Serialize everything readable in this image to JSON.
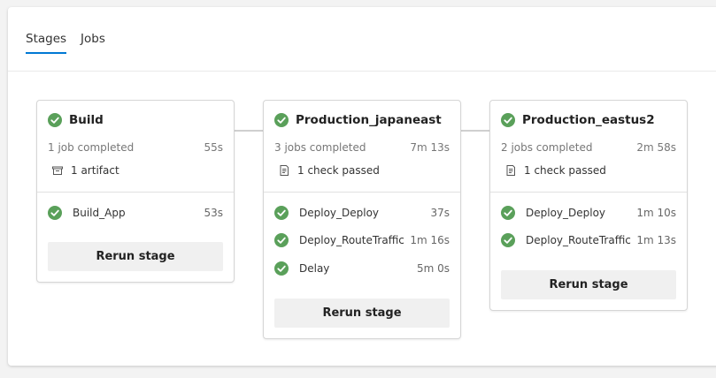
{
  "tabs": [
    {
      "label": "Stages"
    },
    {
      "label": "Jobs"
    }
  ],
  "colors": {
    "success": "#5aa05a",
    "tab_accent": "#0078d4"
  },
  "stages": [
    {
      "title": "Build",
      "status": "1 job completed",
      "duration": "55s",
      "meta": "1 artifact",
      "meta_icon": "artifact-icon",
      "jobs": [
        {
          "name": "Build_App",
          "duration": "53s"
        }
      ],
      "rerun_label": "Rerun stage"
    },
    {
      "title": "Production_japaneast",
      "status": "3 jobs completed",
      "duration": "7m 13s",
      "meta": "1 check passed",
      "meta_icon": "checklist-icon",
      "jobs": [
        {
          "name": "Deploy_Deploy",
          "duration": "37s"
        },
        {
          "name": "Deploy_RouteTraffic",
          "duration": "1m 16s"
        },
        {
          "name": "Delay",
          "duration": "5m 0s"
        }
      ],
      "rerun_label": "Rerun stage"
    },
    {
      "title": "Production_eastus2",
      "status": "2 jobs completed",
      "duration": "2m 58s",
      "meta": "1 check passed",
      "meta_icon": "checklist-icon",
      "jobs": [
        {
          "name": "Deploy_Deploy",
          "duration": "1m 10s"
        },
        {
          "name": "Deploy_RouteTraffic",
          "duration": "1m 13s"
        }
      ],
      "rerun_label": "Rerun stage"
    }
  ]
}
